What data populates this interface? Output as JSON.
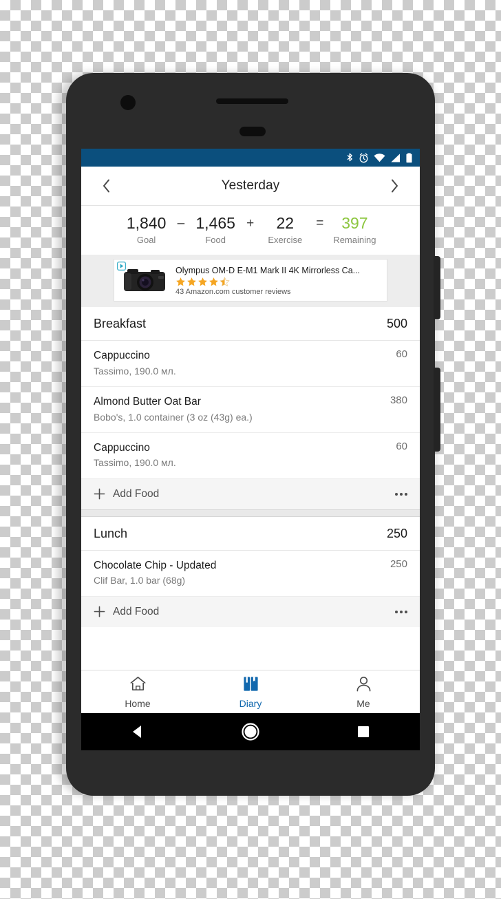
{
  "status_bar": {
    "background": "#0b4f7d",
    "icons": [
      "bluetooth-icon",
      "alarm-icon",
      "wifi-icon",
      "cellular-signal-icon",
      "battery-icon"
    ]
  },
  "header": {
    "title": "Yesterday",
    "prev_label": "‹",
    "next_label": "›"
  },
  "summary": {
    "items": [
      {
        "value": "1,840",
        "label": "Goal"
      },
      {
        "value": "1,465",
        "label": "Food"
      },
      {
        "value": "22",
        "label": "Exercise"
      },
      {
        "value": "397",
        "label": "Remaining"
      }
    ],
    "operators": [
      "–",
      "+",
      "="
    ],
    "remaining_color": "#8cc63e"
  },
  "ad": {
    "title": "Olympus OM-D E-M1 Mark II 4K Mirrorless Ca...",
    "reviews": "43 Amazon.com customer reviews",
    "rating": 4.5,
    "star_color": "#f5a623",
    "adchoices_label": "AdChoices"
  },
  "diary": {
    "meals": [
      {
        "name": "Breakfast",
        "calories": "500",
        "foods": [
          {
            "name": "Cappuccino",
            "desc": "Tassimo, 190.0 мл.",
            "calories": "60"
          },
          {
            "name": "Almond Butter Oat Bar",
            "desc": "Bobo's, 1.0 container (3 oz (43g) ea.)",
            "calories": "380"
          },
          {
            "name": "Cappuccino",
            "desc": "Tassimo, 190.0 мл.",
            "calories": "60"
          }
        ],
        "add_food_label": "Add Food"
      },
      {
        "name": "Lunch",
        "calories": "250",
        "foods": [
          {
            "name": "Chocolate Chip - Updated",
            "desc": "Clif Bar, 1.0 bar (68g)",
            "calories": "250"
          }
        ],
        "add_food_label": "Add Food"
      }
    ]
  },
  "tabs": [
    {
      "label": "Home",
      "icon": "home-icon",
      "active": false
    },
    {
      "label": "Diary",
      "icon": "book-icon",
      "active": true
    },
    {
      "label": "Me",
      "icon": "person-icon",
      "active": false
    }
  ],
  "tab_active_color": "#1168ae",
  "android_nav": {
    "back_label": "Back",
    "home_label": "Home",
    "recents_label": "Recent apps"
  }
}
